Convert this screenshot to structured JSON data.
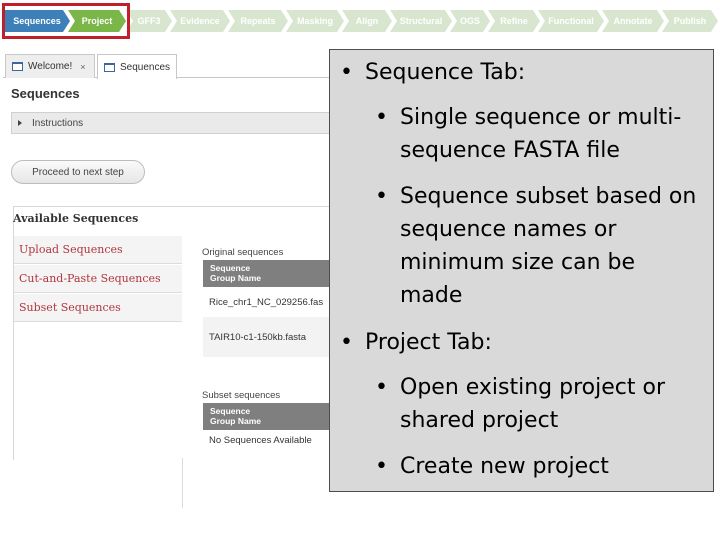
{
  "workflow": {
    "steps": [
      "Sequences",
      "Project",
      "GFF3",
      "Evidence",
      "Repeats",
      "Masking",
      "Align",
      "Structural",
      "OGS",
      "Refine",
      "Functional",
      "Annotate",
      "Publish"
    ],
    "colors": {
      "active": "#3d7fb8",
      "current": "#7ab648",
      "inactive": "#d8e6cf",
      "highlight": "#c0202a"
    }
  },
  "tabs": [
    {
      "label": "Welcome!",
      "close": "×",
      "icon": "window-icon"
    },
    {
      "label": "Sequences",
      "icon": "window-icon"
    }
  ],
  "page": {
    "title": "Sequences",
    "instructions_label": "Instructions",
    "proceed_label": "Proceed to next step"
  },
  "available": {
    "heading": "Available Sequences",
    "links": [
      "Upload Sequences",
      "Cut-and-Paste Sequences",
      "Subset Sequences"
    ],
    "link_color": "#b0363f"
  },
  "original": {
    "label": "Original sequences",
    "header": [
      "Sequence",
      "Group Name"
    ],
    "rows": [
      "Rice_chr1_NC_029256.fas",
      "TAIR10-c1-150kb.fasta"
    ]
  },
  "subset": {
    "label": "Subset sequences",
    "header": [
      "Sequence",
      "Group Name"
    ],
    "rows": [
      "No Sequences Available"
    ]
  },
  "overlay": {
    "bullet_char": "•",
    "bullets": [
      {
        "level": 1,
        "text": "Sequence Tab:"
      },
      {
        "level": 2,
        "lines": [
          "Single sequence or multi-",
          "sequence FASTA file"
        ]
      },
      {
        "level": 2,
        "lines": [
          "Sequence subset based on",
          "sequence names or",
          "minimum size can be",
          "made"
        ]
      },
      {
        "level": 1,
        "text": "Project Tab:"
      },
      {
        "level": 2,
        "lines": [
          "Open existing project or",
          "shared project"
        ]
      },
      {
        "level": 2,
        "lines": [
          "Create new project"
        ]
      }
    ]
  }
}
